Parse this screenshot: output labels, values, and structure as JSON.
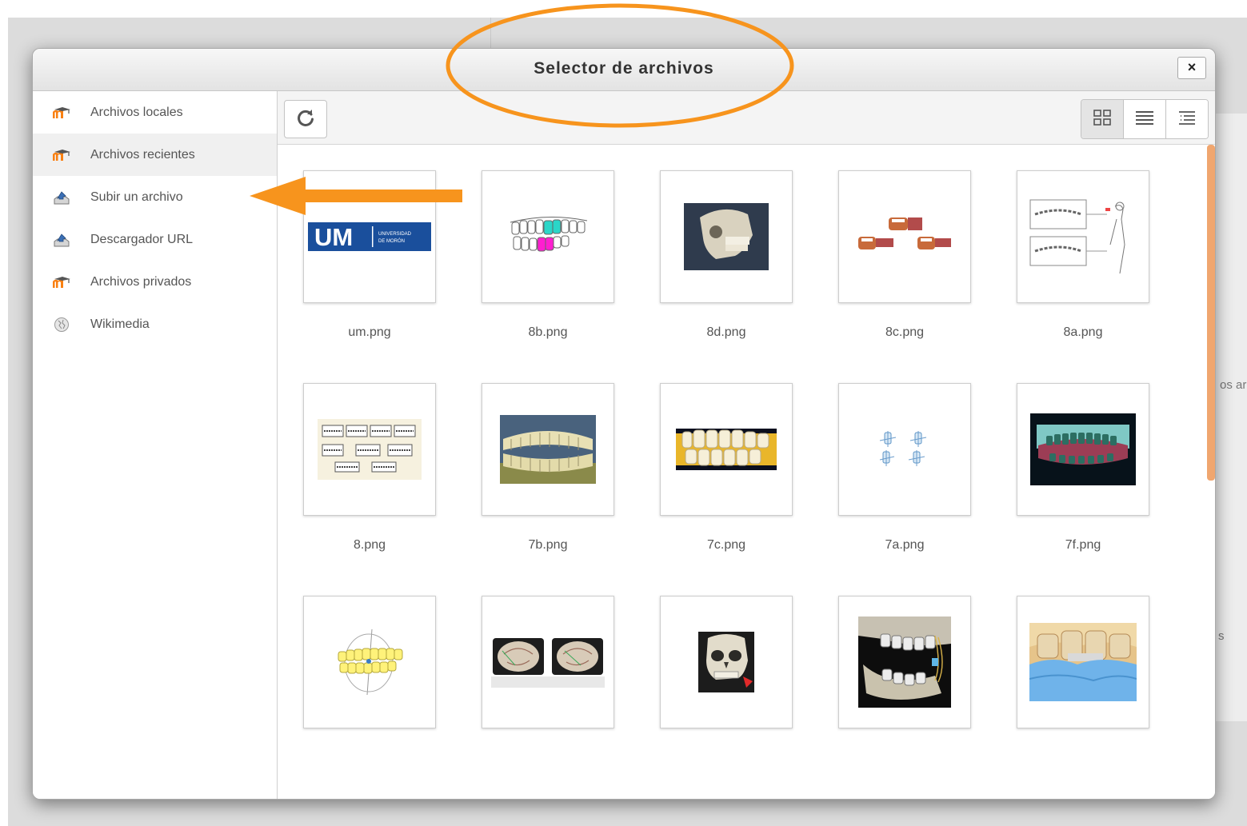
{
  "dialog": {
    "title": "Selector de archivos",
    "close_label": "×"
  },
  "sidebar": {
    "items": [
      {
        "label": "Archivos locales",
        "icon": "moodle-icon",
        "active": false
      },
      {
        "label": "Archivos recientes",
        "icon": "moodle-icon",
        "active": true
      },
      {
        "label": "Subir un archivo",
        "icon": "upload-icon",
        "active": false
      },
      {
        "label": "Descargador URL",
        "icon": "url-download-icon",
        "active": false
      },
      {
        "label": "Archivos privados",
        "icon": "moodle-icon",
        "active": false
      },
      {
        "label": "Wikimedia",
        "icon": "wikimedia-icon",
        "active": false
      }
    ]
  },
  "toolbar": {
    "refresh_icon": "refresh-icon",
    "view_icons": [
      "view-icons-icon",
      "view-list-icon",
      "view-tree-icon"
    ]
  },
  "files": [
    {
      "name": "um.png",
      "thumb": "um-logo"
    },
    {
      "name": "8b.png",
      "thumb": "teeth-color"
    },
    {
      "name": "8d.png",
      "thumb": "skull-3d"
    },
    {
      "name": "8c.png",
      "thumb": "jaw-models"
    },
    {
      "name": "8a.png",
      "thumb": "diagram-profile"
    },
    {
      "name": "8.png",
      "thumb": "sketches"
    },
    {
      "name": "7b.png",
      "thumb": "denture-photo"
    },
    {
      "name": "7c.png",
      "thumb": "teeth-yellow"
    },
    {
      "name": "7a.png",
      "thumb": "teeth-small"
    },
    {
      "name": "7f.png",
      "thumb": "denture-dark"
    },
    {
      "name": "",
      "thumb": "teeth-line"
    },
    {
      "name": "",
      "thumb": "molars-photo"
    },
    {
      "name": "",
      "thumb": "skull-small"
    },
    {
      "name": "",
      "thumb": "jaw-xray"
    },
    {
      "name": "",
      "thumb": "dental-blue"
    }
  ],
  "edge": {
    "text1": "os ar",
    "text2": "s"
  },
  "colors": {
    "annotation": "#f7941d",
    "moodle_orange": "#f98012",
    "um_blue": "#1a4f9c"
  }
}
